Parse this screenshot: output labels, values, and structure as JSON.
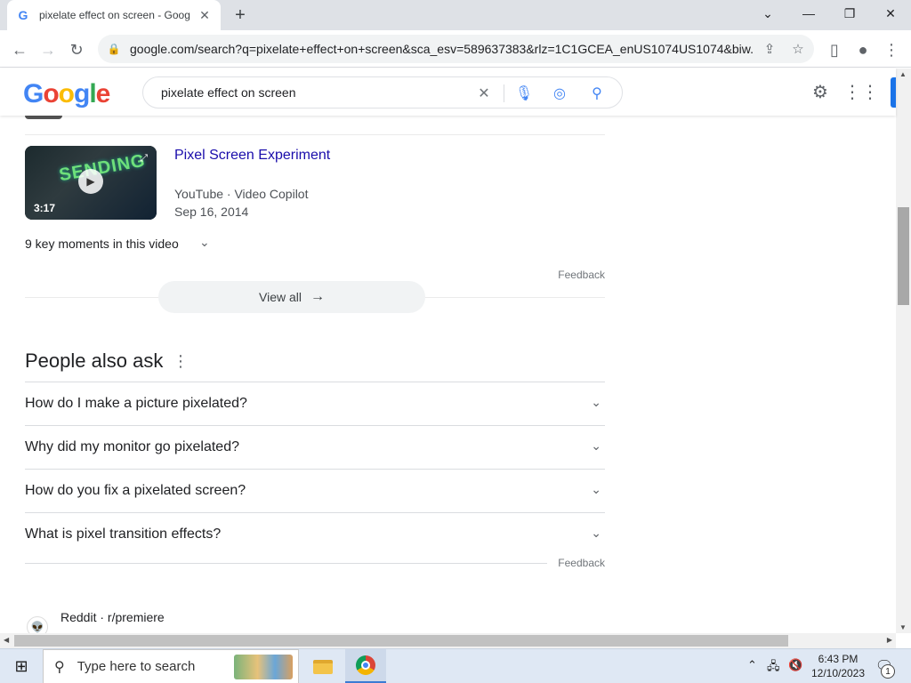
{
  "browser": {
    "tab_title": "pixelate effect on screen - Goog",
    "tab_favicon": "G",
    "url": "google.com/search?q=pixelate+effect+on+screen&sca_esv=589637383&rlz=1C1GCEA_enUS1074US1074&biw..."
  },
  "google": {
    "logo_text": "Google",
    "search_query": "pixelate effect on screen"
  },
  "video": {
    "title": "Pixel Screen Experiment",
    "source": "YouTube · Video Copilot",
    "date": "Sep 16, 2014",
    "duration": "3:17",
    "thumb_text": "SENDING",
    "key_moments": "9 key moments in this video"
  },
  "feedback_label": "Feedback",
  "view_all_label": "View all",
  "people_also_ask": {
    "title": "People also ask",
    "questions": [
      "How do I make a picture pixelated?",
      "Why did my monitor go pixelated?",
      "How do you fix a pixelated screen?",
      "What is pixel transition effects?"
    ]
  },
  "next_result": {
    "source": "Reddit · r/premiere"
  },
  "taskbar": {
    "search_placeholder": "Type here to search",
    "time": "6:43 PM",
    "date": "12/10/2023",
    "notification_count": "1"
  },
  "colors": {
    "link": "#1a0dab",
    "accent": "#1a73e8",
    "taskbar": "#dfe8f4"
  }
}
